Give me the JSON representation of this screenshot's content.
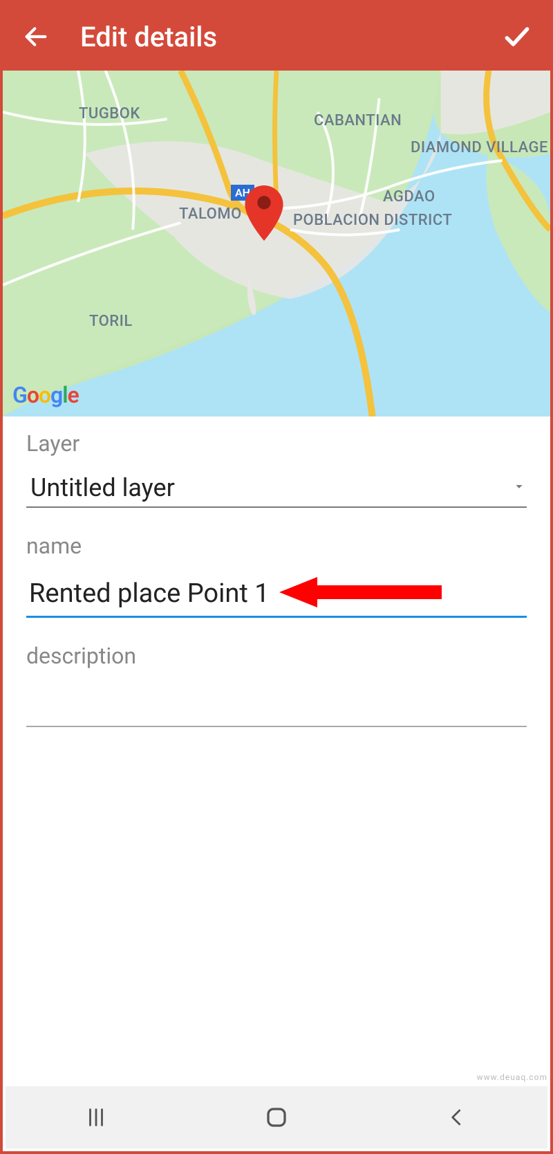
{
  "appbar": {
    "title": "Edit details"
  },
  "map": {
    "attribution": "Google",
    "labels": [
      "TUGBOK",
      "CABANTIAN",
      "DIAMOND VILLAGE",
      "AGDAO",
      "TALOMO",
      "POBLACION DISTRICT",
      "TORIL"
    ],
    "road_sign": "AH"
  },
  "form": {
    "layer": {
      "label": "Layer",
      "value": "Untitled layer"
    },
    "name": {
      "label": "name",
      "value": "Rented place Point 1"
    },
    "description": {
      "label": "description",
      "value": ""
    }
  },
  "watermark": "www.deuaq.com"
}
